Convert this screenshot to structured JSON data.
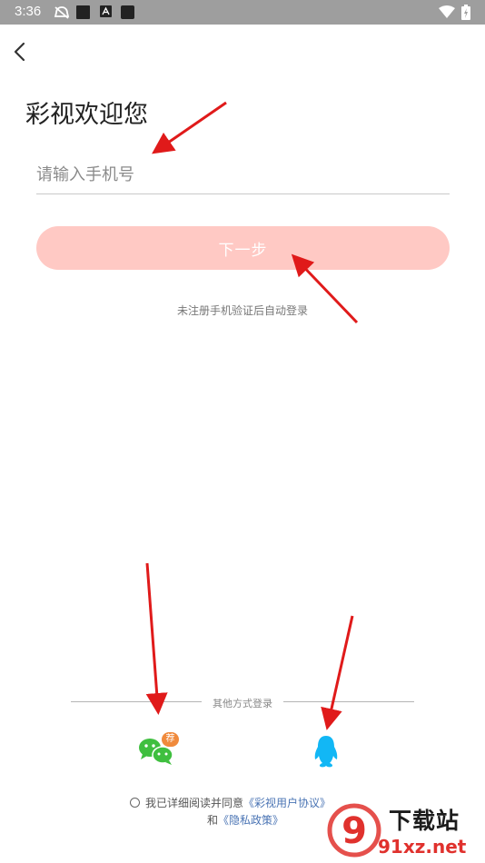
{
  "status_bar": {
    "time": "3:36",
    "left_icons": [
      "notification-mute-icon",
      "square-app-icon",
      "a-app-icon",
      "square-app-icon"
    ],
    "right_icons": [
      "wifi-icon",
      "battery-icon"
    ],
    "background": "#9e9e9e"
  },
  "header": {
    "back_icon": "chevron-left-icon"
  },
  "login": {
    "title": "彩视欢迎您",
    "phone_placeholder": "请输入手机号",
    "next_label": "下一步",
    "hint": "未注册手机验证后自动登录"
  },
  "other_login": {
    "label": "其他方式登录",
    "options": [
      {
        "name": "wechat",
        "icon": "wechat-icon",
        "badge": "荐",
        "color": "#3fbf3f"
      },
      {
        "name": "qq",
        "icon": "qq-penguin-icon",
        "color": "#12b7f5"
      }
    ]
  },
  "agreement": {
    "prefix": "我已详细阅读并同意",
    "user_agreement": "《彩视用户协议》",
    "conjunction": "和",
    "privacy_policy": "《隐私政策》"
  },
  "watermark": {
    "logo_text": "9",
    "brand": "下载站",
    "url": "91xz.net"
  },
  "colors": {
    "primary_button": "#ffc9c4",
    "link": "#4a74b4",
    "annotation_arrow": "#e01a1a"
  }
}
